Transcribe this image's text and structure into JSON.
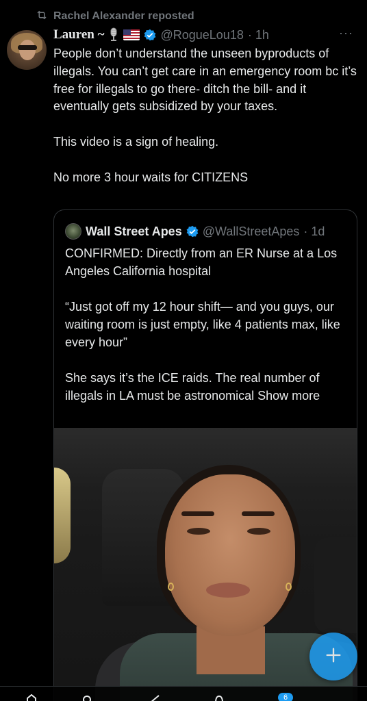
{
  "repost": {
    "text": "Rachel Alexander reposted",
    "icon": "repost-icon"
  },
  "post": {
    "author_name": "Lauren ~",
    "author_emojis": [
      "microphone-emoji",
      "us-flag-emoji"
    ],
    "verified": true,
    "handle": "@RogueLou18",
    "time": "· 1h",
    "more": "···",
    "lines": [
      "People don’t understand the unseen byproducts of illegals. You can’t get care in an emergency room bc it’s free for illegals to go there- ditch the bill- and it eventually gets subsidized by your taxes.",
      "This video is a sign of healing.",
      "No more 3 hour waits for CITIZENS"
    ]
  },
  "quote": {
    "author_name": "Wall Street Apes",
    "verified": true,
    "handle": "@WallStreetApes",
    "time": "· 1d",
    "paragraphs": [
      "CONFIRMED: Directly from an ER Nurse at a Los Angeles California hospital",
      "“Just got off my 12 hour shift— and you guys, our waiting room is just empty, like 4 patients max, like every hour”",
      "She says it’s the ICE raids. The real number of illegals in LA must be astronomical Show more"
    ],
    "media": "video-thumbnail"
  },
  "fab": {
    "icon": "plus-icon"
  },
  "bottom_nav": {
    "items": [
      "home-icon",
      "search-icon",
      "grok-icon",
      "notifications-icon",
      "messages-icon"
    ],
    "notif_count": "6"
  },
  "colors": {
    "background": "#000000",
    "text": "#e7e9ea",
    "secondary": "#71767b",
    "accent": "#1d9bf0",
    "border": "#2f3336"
  }
}
